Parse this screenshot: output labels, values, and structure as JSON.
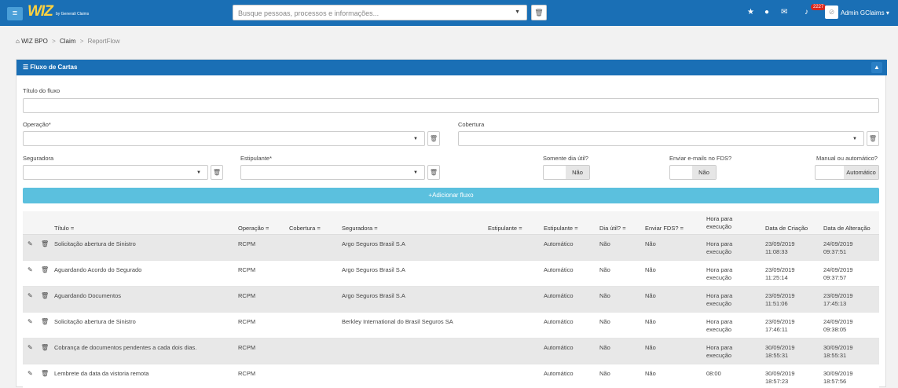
{
  "header": {
    "menu_icon": "hamburger-icon",
    "logo_text": "WIZ",
    "logo_sub": "by Generali Claims",
    "search_placeholder": "Busque pessoas, processos e informações...",
    "notifications_count": "2227",
    "user_name": "Admin GClaims"
  },
  "breadcrumb": {
    "home": "WIZ BPO",
    "sep": ">",
    "claim": "Claim",
    "current": "ReportFlow"
  },
  "panel": {
    "title": "Fluxo de Cartas",
    "fields": {
      "titulo_label": "Título do fluxo",
      "operacao_label": "Operação*",
      "cobertura_label": "Cobertura",
      "seguradora_label": "Seguradora",
      "estipulante_label": "Estipulante*",
      "dia_util_label": "Somente dia útil?",
      "dia_util_value": "Não",
      "fds_label": "Enviar e-mails no FDS?",
      "fds_value": "Não",
      "manual_label": "Manual ou automático?",
      "manual_value": "Automático"
    },
    "add_button": "+Adicionar fluxo"
  },
  "table": {
    "headers": {
      "titulo": "Título",
      "operacao": "Operação",
      "cobertura": "Cobertura",
      "seguradora": "Seguradora",
      "estipulante1": "Estipulante",
      "estipulante2": "Estipulante",
      "dia_util": "Dia útil?",
      "fds": "Enviar FDS?",
      "hora_l1": "Hora para",
      "hora_l2": "execução",
      "criacao": "Data de Criação",
      "alteracao": "Data de Alteração",
      "sort_mark": "="
    },
    "rows": [
      {
        "titulo": "Solicitação abertura de Sinistro",
        "operacao": "RCPM",
        "seguradora": "Argo Seguros Brasil S.A",
        "estipulante": "Automático",
        "dia_util": "Não",
        "fds": "Não",
        "hora_l1": "Hora para",
        "hora_l2": "execução",
        "criacao_d": "23/09/2019",
        "criacao_t": "11:08:33",
        "alteracao_d": "24/09/2019",
        "alteracao_t": "09:37:51"
      },
      {
        "titulo": "Aguardando Acordo do Segurado",
        "operacao": "RCPM",
        "seguradora": "Argo Seguros Brasil S.A",
        "estipulante": "Automático",
        "dia_util": "Não",
        "fds": "Não",
        "hora_l1": "Hora para",
        "hora_l2": "execução",
        "criacao_d": "23/09/2019",
        "criacao_t": "11:25:14",
        "alteracao_d": "24/09/2019",
        "alteracao_t": "09:37:57"
      },
      {
        "titulo": "Aguardando Documentos",
        "operacao": "RCPM",
        "seguradora": "Argo Seguros Brasil S.A",
        "estipulante": "Automático",
        "dia_util": "Não",
        "fds": "Não",
        "hora_l1": "Hora para",
        "hora_l2": "execução",
        "criacao_d": "23/09/2019",
        "criacao_t": "11:51:06",
        "alteracao_d": "23/09/2019",
        "alteracao_t": "17:45:13"
      },
      {
        "titulo": "Solicitação abertura de Sinistro",
        "operacao": "RCPM",
        "seguradora": "Berkley International do Brasil Seguros SA",
        "estipulante": "Automático",
        "dia_util": "Não",
        "fds": "Não",
        "hora_l1": "Hora para",
        "hora_l2": "execução",
        "criacao_d": "23/09/2019",
        "criacao_t": "17:46:11",
        "alteracao_d": "24/09/2019",
        "alteracao_t": "09:38:05"
      },
      {
        "titulo": "Cobrança de documentos pendentes a cada dois dias.",
        "operacao": "RCPM",
        "seguradora": "",
        "estipulante": "Automático",
        "dia_util": "Não",
        "fds": "Não",
        "hora_l1": "Hora para",
        "hora_l2": "execução",
        "criacao_d": "30/09/2019",
        "criacao_t": "18:55:31",
        "alteracao_d": "30/09/2019",
        "alteracao_t": "18:55:31"
      },
      {
        "titulo": "Lembrete da data da vistoria remota",
        "operacao": "RCPM",
        "seguradora": "",
        "estipulante": "Automático",
        "dia_util": "Não",
        "fds": "Não",
        "hora_l1": "08:00",
        "hora_l2": "",
        "criacao_d": "30/09/2019",
        "criacao_t": "18:57:23",
        "alteracao_d": "30/09/2019",
        "alteracao_t": "18:57:56"
      }
    ]
  },
  "colors": {
    "primary": "#1a6fb5",
    "info": "#5bc0de",
    "logo": "#ffd23f",
    "badge": "#d9261c"
  }
}
